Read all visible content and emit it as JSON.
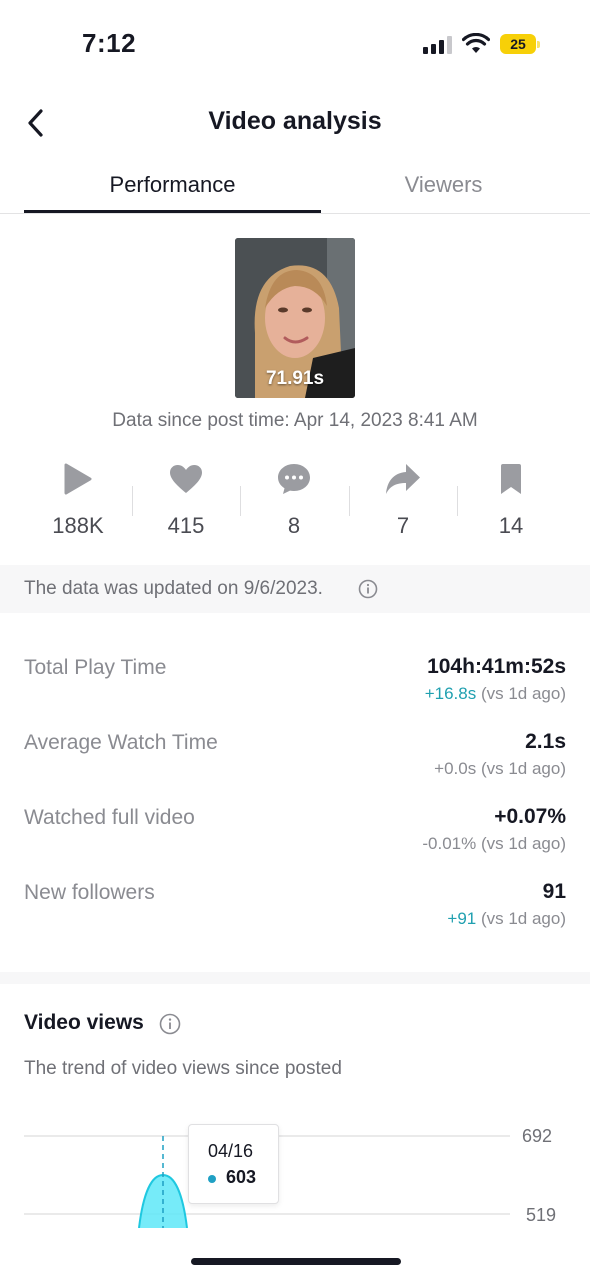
{
  "status": {
    "time": "7:12",
    "battery": "25"
  },
  "nav": {
    "title": "Video analysis"
  },
  "tabs": [
    {
      "label": "Performance"
    },
    {
      "label": "Viewers"
    }
  ],
  "video": {
    "duration": "71.91s",
    "post_time_text": "Data since post time: Apr 14, 2023 8:41 AM"
  },
  "stats": [
    {
      "icon": "play-icon",
      "value": "188K"
    },
    {
      "icon": "heart-icon",
      "value": "415"
    },
    {
      "icon": "comment-icon",
      "value": "8"
    },
    {
      "icon": "share-icon",
      "value": "7"
    },
    {
      "icon": "bookmark-icon",
      "value": "14"
    }
  ],
  "update_notice": "The data was updated on 9/6/2023.",
  "metrics": [
    {
      "label": "Total Play Time",
      "value": "104h:41m:52s",
      "delta": "+16.8s",
      "delta_suffix": " (vs 1d ago)"
    },
    {
      "label": "Average Watch Time",
      "value": "2.1s",
      "delta": "+0.0s",
      "delta_suffix": " (vs 1d ago)"
    },
    {
      "label": "Watched full video",
      "value": "+0.07%",
      "delta": "-0.01%",
      "delta_suffix": " (vs 1d ago)"
    },
    {
      "label": "New followers",
      "value": "91",
      "delta": "+91",
      "delta_suffix": " (vs 1d ago)"
    }
  ],
  "video_views": {
    "title": "Video views",
    "subtitle": "The trend of video views since posted"
  },
  "chart_data": {
    "type": "area",
    "y_ticks": [
      "692",
      "519"
    ],
    "tooltip": {
      "date": "04/16",
      "value": "603"
    },
    "color": "#5ee8f8",
    "stroke": "#1fc8e0"
  },
  "colors": {
    "accent": "#20a0b0",
    "text": "#161823",
    "muted": "#8a8b91"
  }
}
